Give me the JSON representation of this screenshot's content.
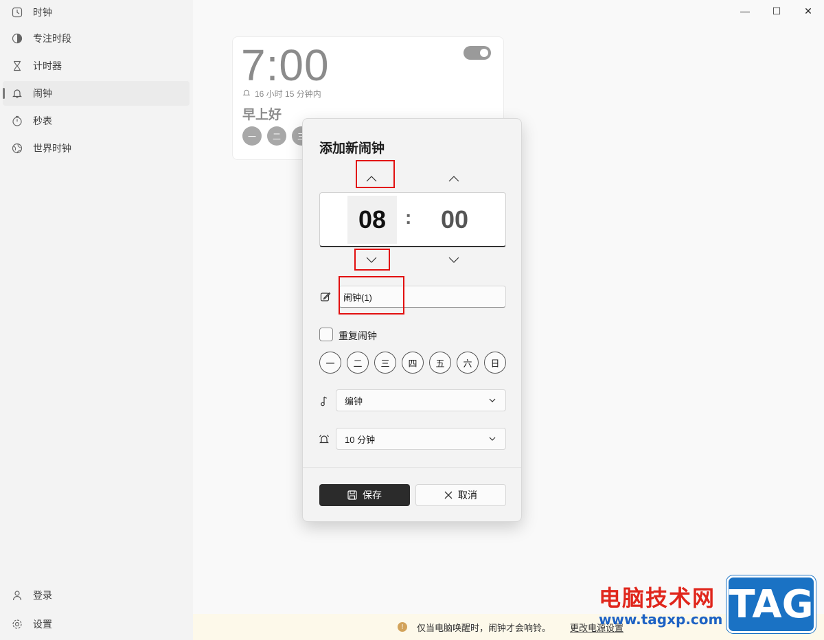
{
  "sidebar": {
    "items": [
      {
        "label": "时钟",
        "icon": "clock-icon"
      },
      {
        "label": "专注时段",
        "icon": "focus-icon"
      },
      {
        "label": "计时器",
        "icon": "hourglass-icon"
      },
      {
        "label": "闹钟",
        "icon": "bell-icon",
        "active": true
      },
      {
        "label": "秒表",
        "icon": "stopwatch-icon"
      },
      {
        "label": "世界时钟",
        "icon": "globe-icon"
      }
    ],
    "login_label": "登录",
    "settings_label": "设置"
  },
  "window": {
    "minimize": "—",
    "maximize": "☐",
    "close": "✕"
  },
  "alarm_card": {
    "time": "7:00",
    "remaining": "16 小时 15 分钟内",
    "name": "早上好",
    "days": [
      "一",
      "二",
      "三"
    ],
    "enabled": true
  },
  "dialog": {
    "title": "添加新闹钟",
    "hour": "08",
    "separator": ":",
    "minute": "00",
    "name_value": "闹钟(1)",
    "repeat_label": "重复闹钟",
    "days": [
      "一",
      "二",
      "三",
      "四",
      "五",
      "六",
      "日"
    ],
    "sound_value": "编钟",
    "snooze_value": "10 分钟",
    "save_label": "保存",
    "cancel_label": "取消"
  },
  "info_bar": {
    "message": "仅当电脑唤醒时，闹钟才会响铃。",
    "link": "更改电源设置"
  },
  "watermark": {
    "site_name": "电脑技术网",
    "url": "www.tagxp.com",
    "logo_text": "TAG"
  },
  "colors": {
    "highlight": "#e20f0f",
    "accent_dark": "#2b2b2b",
    "watermark_red": "#e0261c",
    "watermark_blue": "#1a72c4"
  }
}
